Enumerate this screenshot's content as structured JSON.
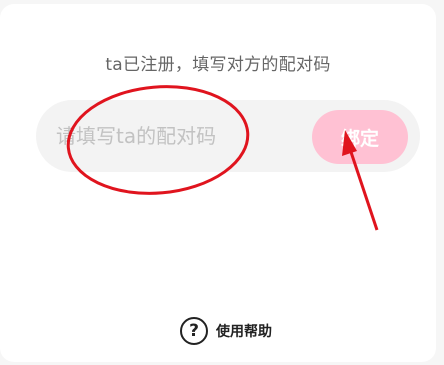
{
  "bind_panel": {
    "instruction": "ta已注册，填写对方的配对码",
    "code_input": {
      "placeholder": "请填写ta的配对码",
      "value": ""
    },
    "bind_button_label": "绑定"
  },
  "help": {
    "icon": "question-circle-icon",
    "label": "使用帮助"
  },
  "colors": {
    "bind_button": "#ffc1d3",
    "annotation": "#e0141e"
  }
}
